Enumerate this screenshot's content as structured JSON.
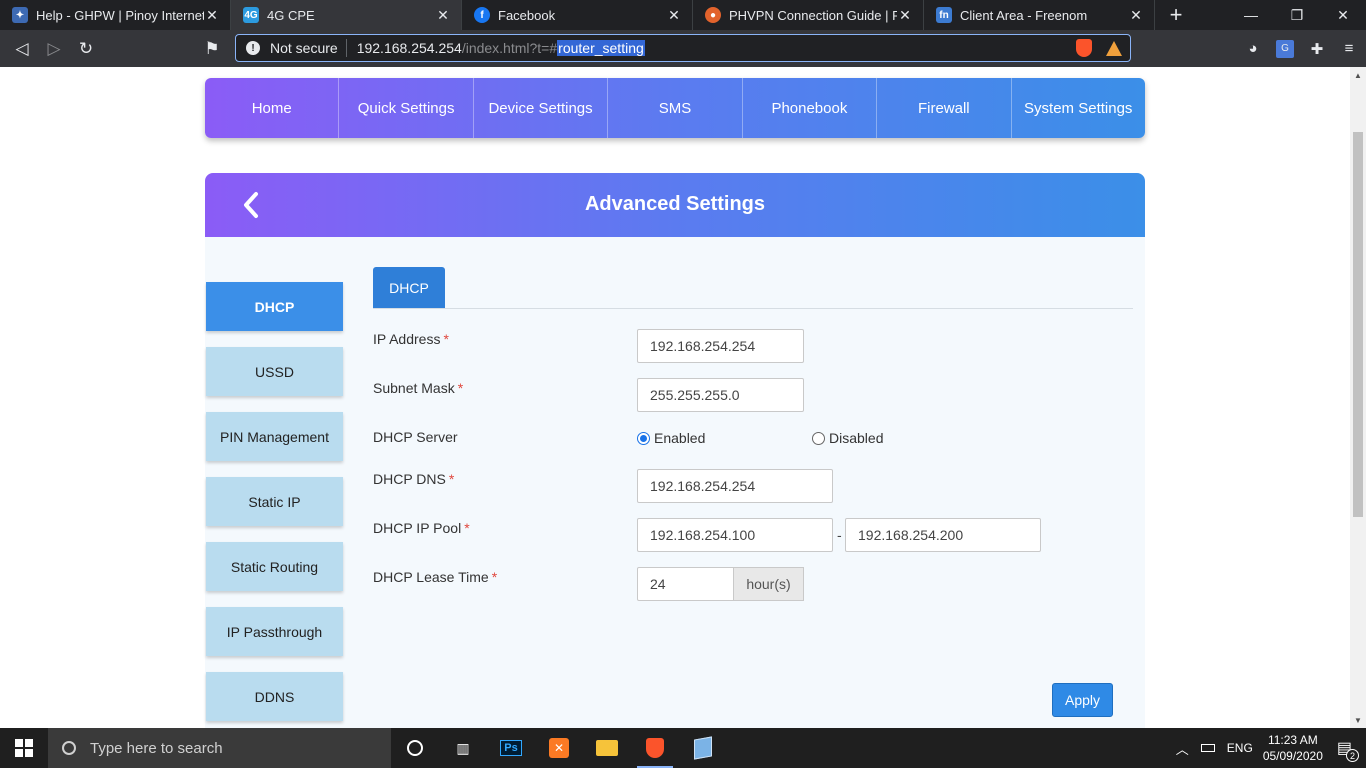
{
  "browser": {
    "tabs": [
      {
        "title": "Help - GHPW | Pinoy Internet and",
        "favicon_color": "#3d6ab3"
      },
      {
        "title": "4G CPE",
        "favicon_color": "#2c9be0",
        "active": true
      },
      {
        "title": "Facebook",
        "favicon_color": "#1877f2"
      },
      {
        "title": "PHVPN Connection Guide | Philip",
        "favicon_color": "#e2632c"
      },
      {
        "title": "Client Area - Freenom",
        "favicon_color": "#3c7bd1"
      }
    ],
    "new_tab_symbol": "+",
    "security_label": "Not secure",
    "url_host": "192.168.254.254",
    "url_path": "/index.html?t=#",
    "url_selected": "router_setting"
  },
  "nav": {
    "items": [
      "Home",
      "Quick Settings",
      "Device Settings",
      "SMS",
      "Phonebook",
      "Firewall",
      "System Settings"
    ],
    "gradient": [
      "#8b5cf6",
      "#3b8fe8"
    ]
  },
  "advanced": {
    "title": "Advanced Settings"
  },
  "sidebar": {
    "items": [
      "DHCP",
      "USSD",
      "PIN Management",
      "Static IP",
      "Static Routing",
      "IP Passthrough",
      "DDNS"
    ],
    "active_index": 0
  },
  "dhcp": {
    "tab_label": "DHCP",
    "ip_address_label": "IP Address",
    "ip_address_value": "192.168.254.254",
    "subnet_mask_label": "Subnet Mask",
    "subnet_mask_value": "255.255.255.0",
    "server_label": "DHCP Server",
    "server_enabled_label": "Enabled",
    "server_disabled_label": "Disabled",
    "server_state": "Enabled",
    "dns_label": "DHCP DNS",
    "dns_value": "192.168.254.254",
    "pool_label": "DHCP IP Pool",
    "pool_start": "192.168.254.100",
    "pool_separator": "-",
    "pool_end": "192.168.254.200",
    "lease_label": "DHCP Lease Time",
    "lease_value": "24",
    "lease_unit": "hour(s)",
    "required_mark": "*",
    "apply_label": "Apply",
    "help_symbol": "?"
  },
  "taskbar": {
    "search_placeholder": "Type here to search",
    "language": "ENG",
    "time": "11:23 AM",
    "date": "05/09/2020",
    "notification_count": "2",
    "apps": [
      "task-view",
      "photoshop",
      "xampp",
      "file-explorer",
      "brave",
      "notepad"
    ]
  }
}
